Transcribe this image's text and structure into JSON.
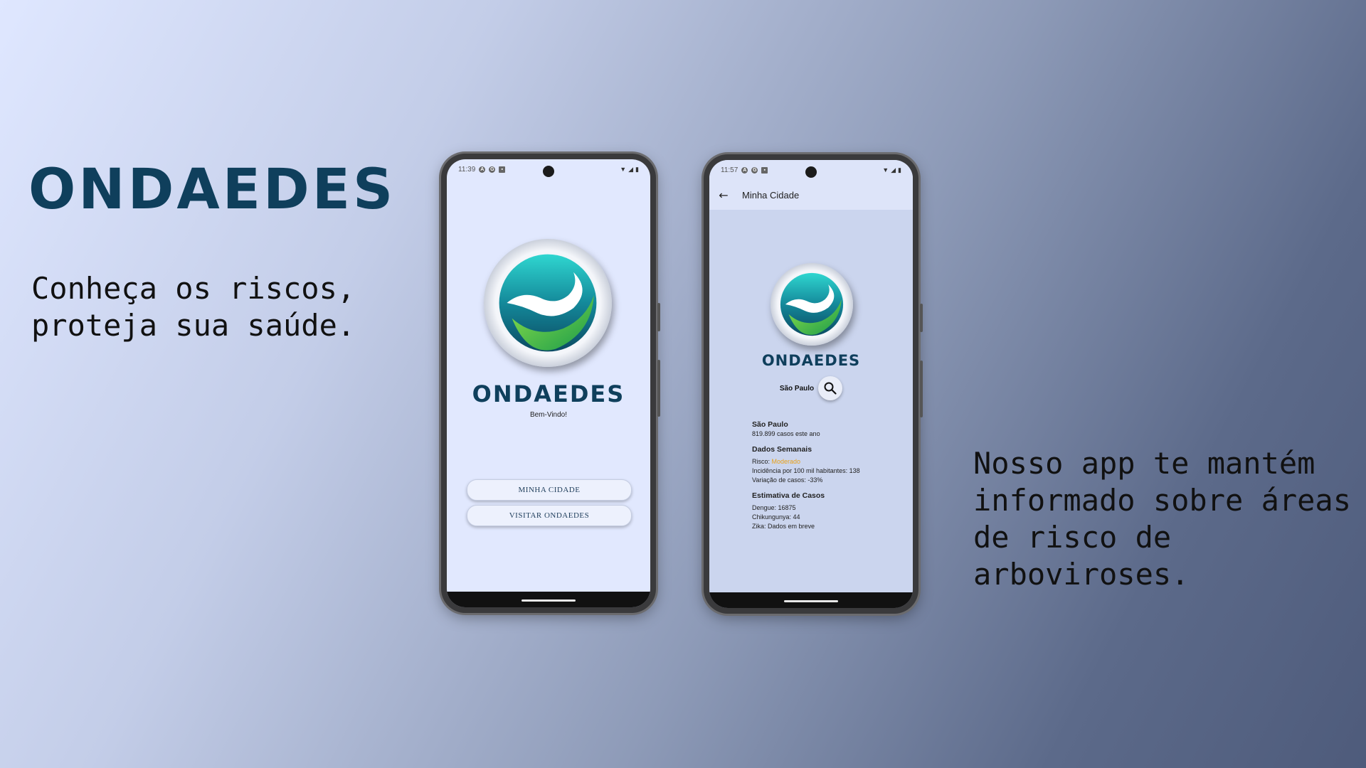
{
  "brand": {
    "title": "ONDAEDES",
    "tagline": "Conheça os riscos, proteja sua saúde.",
    "description": "Nosso app te mantém informado sobre áreas de risco de arboviroses."
  },
  "colors": {
    "brand_dark": "#0f3f5c",
    "risk_moderate": "#e8a11a",
    "button_bg": "#edf1fd"
  },
  "phone1": {
    "status": {
      "time": "11:39",
      "icons": [
        "a-icon",
        "google-icon",
        "sim-icon"
      ]
    },
    "app_name": "ONDAEDES",
    "welcome": "Bem-Vindo!",
    "buttons": {
      "my_city": "MINHA CIDADE",
      "visit": "VISITAR ONDAEDES"
    }
  },
  "phone2": {
    "status": {
      "time": "11:57",
      "icons": [
        "a-icon",
        "google-icon",
        "sim-icon"
      ]
    },
    "appbar": {
      "title": "Minha Cidade",
      "back_icon": "arrow-left-icon"
    },
    "app_name": "ONDAEDES",
    "selected_city": "São Paulo",
    "search_icon": "search-icon",
    "city_info": {
      "city": "São Paulo",
      "cases_year": "819.899 casos este ano",
      "weekly_header": "Dados Semanais",
      "risk_label": "Risco: ",
      "risk_value": "Moderado",
      "incidence": "Incidência por 100 mil habitantes: 138",
      "variation": "Variação de casos: -33%",
      "estimate_header": "Estimativa de Casos",
      "dengue": "Dengue: 16875",
      "chikungunya": "Chikungunya: 44",
      "zika": "Zika: Dados em breve"
    }
  }
}
